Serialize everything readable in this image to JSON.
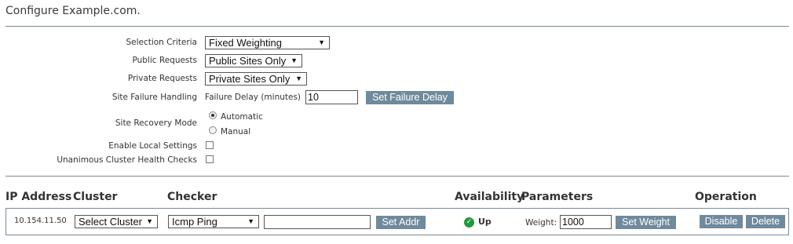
{
  "page": {
    "title": "Configure Example.com."
  },
  "settings": {
    "selection_criteria": {
      "label": "Selection Criteria",
      "value": "Fixed Weighting"
    },
    "public_requests": {
      "label": "Public Requests",
      "value": "Public Sites Only"
    },
    "private_requests": {
      "label": "Private Requests",
      "value": "Private Sites Only"
    },
    "site_failure": {
      "label": "Site Failure Handling",
      "delay_label": "Failure Delay (minutes)",
      "delay_value": "10",
      "button": "Set Failure Delay"
    },
    "site_recovery": {
      "label": "Site Recovery Mode",
      "options": [
        "Automatic",
        "Manual"
      ],
      "selected": "Automatic"
    },
    "enable_local": {
      "label": "Enable Local Settings",
      "checked": false
    },
    "unanimous_health": {
      "label": "Unanimous Cluster Health Checks",
      "checked": false
    }
  },
  "table": {
    "headers": {
      "ip": "IP Address",
      "cluster": "Cluster",
      "checker": "Checker",
      "availability": "Availability",
      "parameters": "Parameters",
      "operation": "Operation"
    },
    "rows": [
      {
        "ip": "10.154.11.50",
        "cluster": "Select Cluster",
        "checker": "Icmp Ping",
        "checker_arg": "",
        "set_addr": "Set Addr",
        "status": "Up",
        "status_color": "#1f9a3c",
        "weight_label": "Weight:",
        "weight": "1000",
        "set_weight": "Set Weight",
        "disable": "Disable",
        "delete": "Delete"
      }
    ]
  },
  "icons": {
    "dropdown": "chevron-down-icon",
    "status": "check-circle-icon"
  },
  "colors": {
    "button": "#6f8a9c",
    "rule": "#7a8a96",
    "status_up": "#1f9a3c"
  }
}
